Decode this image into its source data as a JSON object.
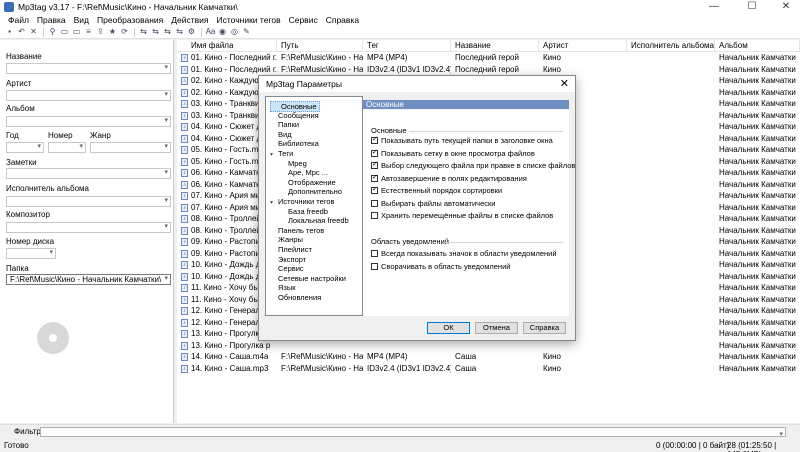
{
  "window": {
    "title": "Mp3tag v3.17  -  F:\\Ref\\Music\\Кино - Начальник Камчатки\\",
    "minimize": "—",
    "maximize": "☐",
    "close": "✕"
  },
  "menu": [
    "Файл",
    "Правка",
    "Вид",
    "Преобразования",
    "Действия",
    "Источники тегов",
    "Сервис",
    "Справка"
  ],
  "toolbar_icons": [
    "save-icon",
    "undo-icon",
    "remove-tag-icon",
    "filter-icon",
    "folder-open-icon",
    "folder-add-icon",
    "playlist-icon",
    "export-icon",
    "favorite-icon",
    "refresh-icon",
    "tag-to-filename-icon",
    "filename-to-tag-icon",
    "text-to-tag-icon",
    "tag-to-tag-icon",
    "action-icon",
    "case-icon",
    "freedb-icon",
    "discogs-icon",
    "options-icon"
  ],
  "left_panel": {
    "title_label": "Название",
    "artist_label": "Артист",
    "album_label": "Альбом",
    "year_label": "Год",
    "track_label": "Номер",
    "genre_label": "Жанр",
    "comment_label": "Заметки",
    "album_artist_label": "Исполнитель альбома",
    "composer_label": "Композитор",
    "disc_label": "Номер диска",
    "folder_label": "Папка",
    "folder_value": "F:\\Ref\\Music\\Кино - Начальник Камчатки\\"
  },
  "columns": [
    "Имя файла",
    "Путь",
    "Тег",
    "Название",
    "Артист",
    "Исполнитель альбома",
    "Альбом"
  ],
  "rows": [
    {
      "file": "01. Кино - Последний г...",
      "path": "F:\\Ref\\Music\\Кино - На",
      "tag": "MP4 (MP4)",
      "title": "Последний герой",
      "artist": "Кино",
      "album": "Начальник Камчатки"
    },
    {
      "file": "01. Кино - Последний г...",
      "path": "F:\\Ref\\Music\\Кино - На",
      "tag": "ID3v2.4 (ID3v1 ID3v2.4)",
      "title": "Последний герой",
      "artist": "Кино",
      "album": "Начальник Камчатки"
    },
    {
      "file": "02. Кино - Каждую но",
      "path": "",
      "tag": "",
      "title": "",
      "artist": "",
      "album": "Начальник Камчатки"
    },
    {
      "file": "02. Кино - Каждую но",
      "path": "",
      "tag": "",
      "title": "",
      "artist": "",
      "album": "Начальник Камчатки"
    },
    {
      "file": "03. Кино - Транквили",
      "path": "",
      "tag": "",
      "title": "",
      "artist": "",
      "album": "Начальник Камчатки"
    },
    {
      "file": "03. Кино - Транквили",
      "path": "",
      "tag": "",
      "title": "",
      "artist": "",
      "album": "Начальник Камчатки"
    },
    {
      "file": "04. Кино - Сюжет для",
      "path": "",
      "tag": "",
      "title": "",
      "artist": "",
      "album": "Начальник Камчатки"
    },
    {
      "file": "04. Кино - Сюжет для",
      "path": "",
      "tag": "",
      "title": "",
      "artist": "",
      "album": "Начальник Камчатки"
    },
    {
      "file": "05. Кино - Гость.m4a",
      "path": "",
      "tag": "",
      "title": "",
      "artist": "",
      "album": "Начальник Камчатки"
    },
    {
      "file": "05. Кино - Гость.mp3",
      "path": "",
      "tag": "",
      "title": "",
      "artist": "",
      "album": "Начальник Камчатки"
    },
    {
      "file": "06. Кино - Камчатка.m",
      "path": "",
      "tag": "",
      "title": "",
      "artist": "",
      "album": "Начальник Камчатки"
    },
    {
      "file": "06. Кино - Камчатка.m",
      "path": "",
      "tag": "",
      "title": "",
      "artist": "",
      "album": "Начальник Камчатки"
    },
    {
      "file": "07. Кино - Ария мисте",
      "path": "",
      "tag": "",
      "title": "",
      "artist": "",
      "album": "Начальник Камчатки"
    },
    {
      "file": "07. Кино - Ария мисте",
      "path": "",
      "tag": "",
      "title": "",
      "artist": "",
      "album": "Начальник Камчатки"
    },
    {
      "file": "08. Кино - Троллейбу",
      "path": "",
      "tag": "",
      "title": "",
      "artist": "",
      "album": "Начальник Камчатки"
    },
    {
      "file": "08. Кино - Троллейбу",
      "path": "",
      "tag": "",
      "title": "",
      "artist": "",
      "album": "Начальник Камчатки"
    },
    {
      "file": "09. Кино - Растопите",
      "path": "",
      "tag": "",
      "title": "",
      "artist": "",
      "album": "Начальник Камчатки"
    },
    {
      "file": "09. Кино - Растопите",
      "path": "",
      "tag": "",
      "title": "",
      "artist": "",
      "album": "Начальник Камчатки"
    },
    {
      "file": "10. Кино - Дождь для",
      "path": "",
      "tag": "",
      "title": "",
      "artist": "",
      "album": "Начальник Камчатки"
    },
    {
      "file": "10. Кино - Дождь для",
      "path": "",
      "tag": "",
      "title": "",
      "artist": "",
      "album": "Начальник Камчатки"
    },
    {
      "file": "11. Кино - Хочу быть",
      "path": "",
      "tag": "",
      "title": "",
      "artist": "",
      "album": "Начальник Камчатки"
    },
    {
      "file": "11. Кино - Хочу быть",
      "path": "",
      "tag": "",
      "title": "",
      "artist": "",
      "album": "Начальник Камчатки"
    },
    {
      "file": "12. Кино - Генерал.m",
      "path": "",
      "tag": "",
      "title": "",
      "artist": "",
      "album": "Начальник Камчатки"
    },
    {
      "file": "12. Кино - Генерал.m",
      "path": "",
      "tag": "",
      "title": "",
      "artist": "",
      "album": "Начальник Камчатки"
    },
    {
      "file": "13. Кино - Прогулка р",
      "path": "",
      "tag": "",
      "title": "",
      "artist": "",
      "album": "Начальник Камчатки"
    },
    {
      "file": "13. Кино - Прогулка р",
      "path": "",
      "tag": "",
      "title": "",
      "artist": "",
      "album": "Начальник Камчатки"
    },
    {
      "file": "14. Кино - Саша.m4a",
      "path": "F:\\Ref\\Music\\Кино - На",
      "tag": "MP4 (MP4)",
      "title": "Саша",
      "artist": "Кино",
      "album": "Начальник Камчатки"
    },
    {
      "file": "14. Кино - Саша.mp3",
      "path": "F:\\Ref\\Music\\Кино - На",
      "tag": "ID3v2.4 (ID3v1 ID3v2.4)",
      "title": "Саша",
      "artist": "Кино",
      "album": "Начальник Камчатки"
    }
  ],
  "filter": {
    "label": "Фильтр:",
    "value": ""
  },
  "status": {
    "left": "Готово",
    "selected": "0 (00:00:00 | 0 байт)",
    "total": "28 (01:25:50 | 145,0MB)"
  },
  "dialog": {
    "title": "Mp3tag Параметры",
    "close": "✕",
    "tree": [
      {
        "label": "Основные",
        "level": 0,
        "selected": true,
        "expand": ""
      },
      {
        "label": "Сообщения",
        "level": 0,
        "expand": ""
      },
      {
        "label": "Папки",
        "level": 0,
        "expand": ""
      },
      {
        "label": "Вид",
        "level": 0,
        "expand": ""
      },
      {
        "label": "Библиотека",
        "level": 0,
        "expand": ""
      },
      {
        "label": "Теги",
        "level": 0,
        "expand": "▾"
      },
      {
        "label": "Mpeg",
        "level": 1,
        "expand": ""
      },
      {
        "label": "Ape, Mpc ...",
        "level": 1,
        "expand": ""
      },
      {
        "label": "Отображение",
        "level": 1,
        "expand": ""
      },
      {
        "label": "Дополнительно",
        "level": 1,
        "expand": ""
      },
      {
        "label": "Источники тегов",
        "level": 0,
        "expand": "▾"
      },
      {
        "label": "База freedb",
        "level": 1,
        "expand": ""
      },
      {
        "label": "Локальная freedb",
        "level": 1,
        "expand": ""
      },
      {
        "label": "Панель тегов",
        "level": 0,
        "expand": ""
      },
      {
        "label": "Жанры",
        "level": 0,
        "expand": ""
      },
      {
        "label": "Плейлист",
        "level": 0,
        "expand": ""
      },
      {
        "label": "Экспорт",
        "level": 0,
        "expand": ""
      },
      {
        "label": "Сервис",
        "level": 0,
        "expand": ""
      },
      {
        "label": "Сетевые настройки",
        "level": 0,
        "expand": ""
      },
      {
        "label": "Язык",
        "level": 0,
        "expand": ""
      },
      {
        "label": "Обновления",
        "level": 0,
        "expand": ""
      }
    ],
    "section_title": "Основные",
    "group_main": "Основные",
    "options": [
      {
        "label": "Показывать путь текущей папки в заголовке окна",
        "checked": true
      },
      {
        "label": "Показывать сетку в окне просмотра файлов",
        "checked": true
      },
      {
        "label": "Выбор следующего файла при правке в списке файлов",
        "checked": true
      },
      {
        "label": "Автозавершение в полях редактирования",
        "checked": true
      },
      {
        "label": "Естественный порядок сортировки",
        "checked": true
      },
      {
        "label": "Выбирать файлы автоматически",
        "checked": false
      },
      {
        "label": "Хранить перемещённые файлы в списке файлов",
        "checked": false
      }
    ],
    "group_notify": "Область уведомлений",
    "notify_options": [
      {
        "label": "Всегда показывать значок в области уведомлений",
        "checked": false
      },
      {
        "label": "Сворачивать в область уведомлений",
        "checked": false
      }
    ],
    "ok": "ОК",
    "cancel": "Отмена",
    "help": "Справка"
  }
}
